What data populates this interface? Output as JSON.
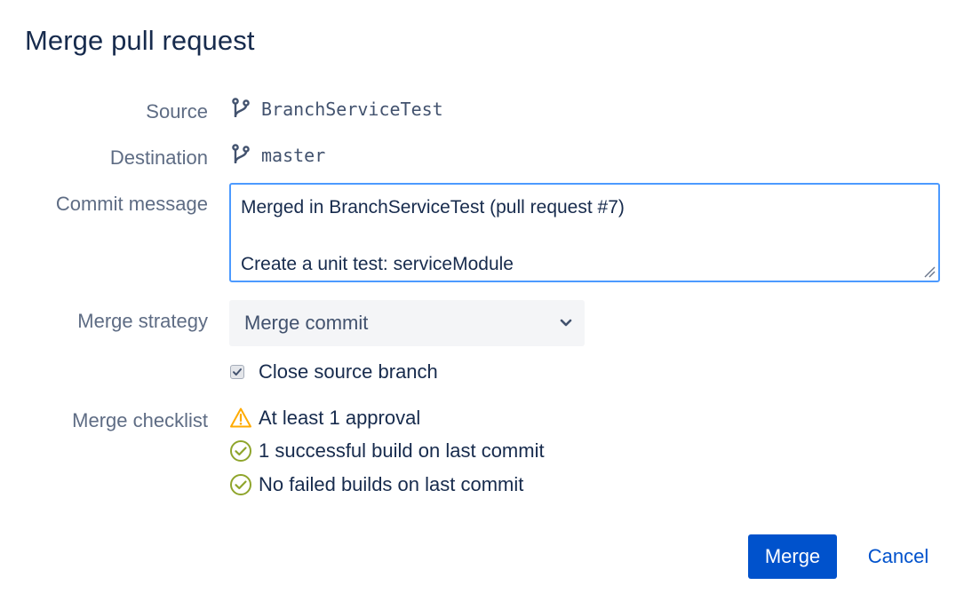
{
  "dialog": {
    "title": "Merge pull request"
  },
  "form": {
    "source_label": "Source",
    "source_branch": "BranchServiceTest",
    "destination_label": "Destination",
    "destination_branch": "master",
    "commit_message_label": "Commit message",
    "commit_message_line1": "Merged in BranchServiceTest (pull request #7)",
    "commit_message_line2": "",
    "commit_message_line3": "Create a unit test: serviceModule",
    "merge_strategy_label": "Merge strategy",
    "merge_strategy_value": "Merge commit",
    "close_source_branch_label": "Close source branch",
    "close_source_branch_checked": true,
    "merge_checklist_label": "Merge checklist"
  },
  "checklist": [
    {
      "icon": "warning-icon",
      "text": "At least 1 approval",
      "color": "#ffab00"
    },
    {
      "icon": "check-circle-icon",
      "text": "1 successful build on last commit",
      "color": "#8fa52c"
    },
    {
      "icon": "check-circle-icon",
      "text": "No failed builds on last commit",
      "color": "#8fa52c"
    }
  ],
  "actions": {
    "merge_label": "Merge",
    "cancel_label": "Cancel"
  },
  "colors": {
    "primary": "#0052cc",
    "focus_border": "#4c9aff",
    "text": "#172b4d",
    "label": "#5e6c84"
  }
}
